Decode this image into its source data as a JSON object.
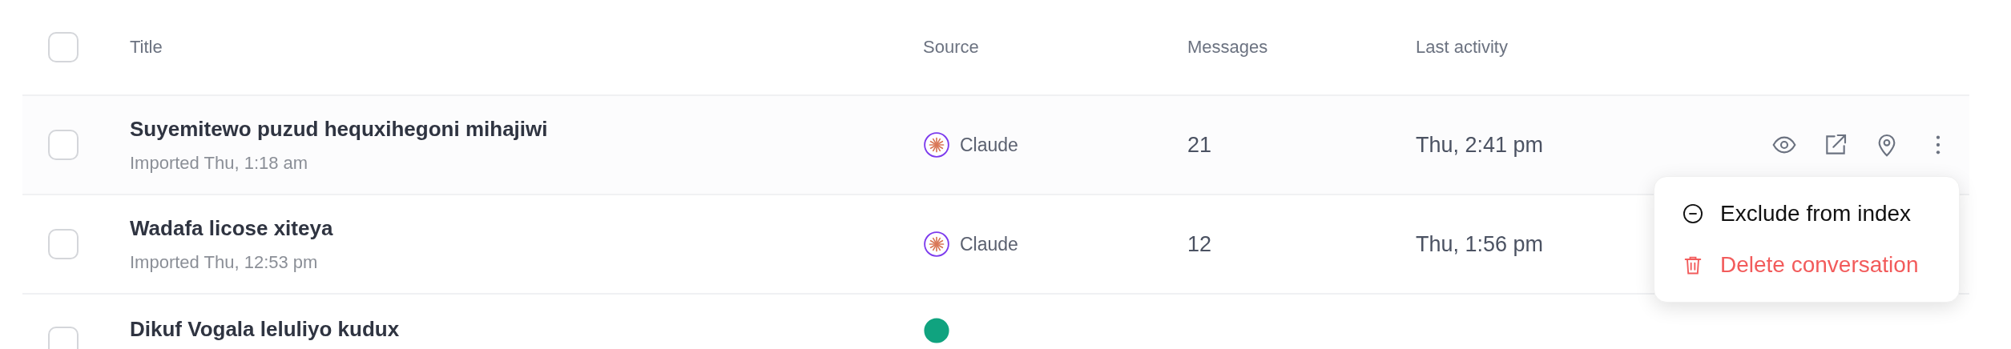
{
  "table": {
    "select_all": {
      "checked": false
    },
    "columns": [
      "Title",
      "Source",
      "Messages",
      "Last activity"
    ],
    "rows": [
      {
        "checked": false,
        "title": "Suyemitewo puzud hequxihegoni mihajiwi",
        "subtitle": "Imported Thu, 1:18 am",
        "source": {
          "kind": "claude",
          "label": "Claude"
        },
        "messages": "21",
        "last_activity": "Thu, 2:41 pm",
        "hovered": true,
        "menu": {
          "items": [
            {
              "kind": "exclude",
              "label": "Exclude from index"
            },
            {
              "kind": "delete",
              "label": "Delete conversation"
            }
          ]
        }
      },
      {
        "checked": false,
        "title": "Wadafa licose xiteya",
        "subtitle": "Imported Thu, 12:53 pm",
        "source": {
          "kind": "claude",
          "label": "Claude"
        },
        "messages": "12",
        "last_activity": "Thu, 1:56 pm"
      },
      {
        "checked": false,
        "title": "Dikuf Vogala leluliyo kudux",
        "source": {
          "kind": "chatgpt"
        }
      }
    ]
  }
}
